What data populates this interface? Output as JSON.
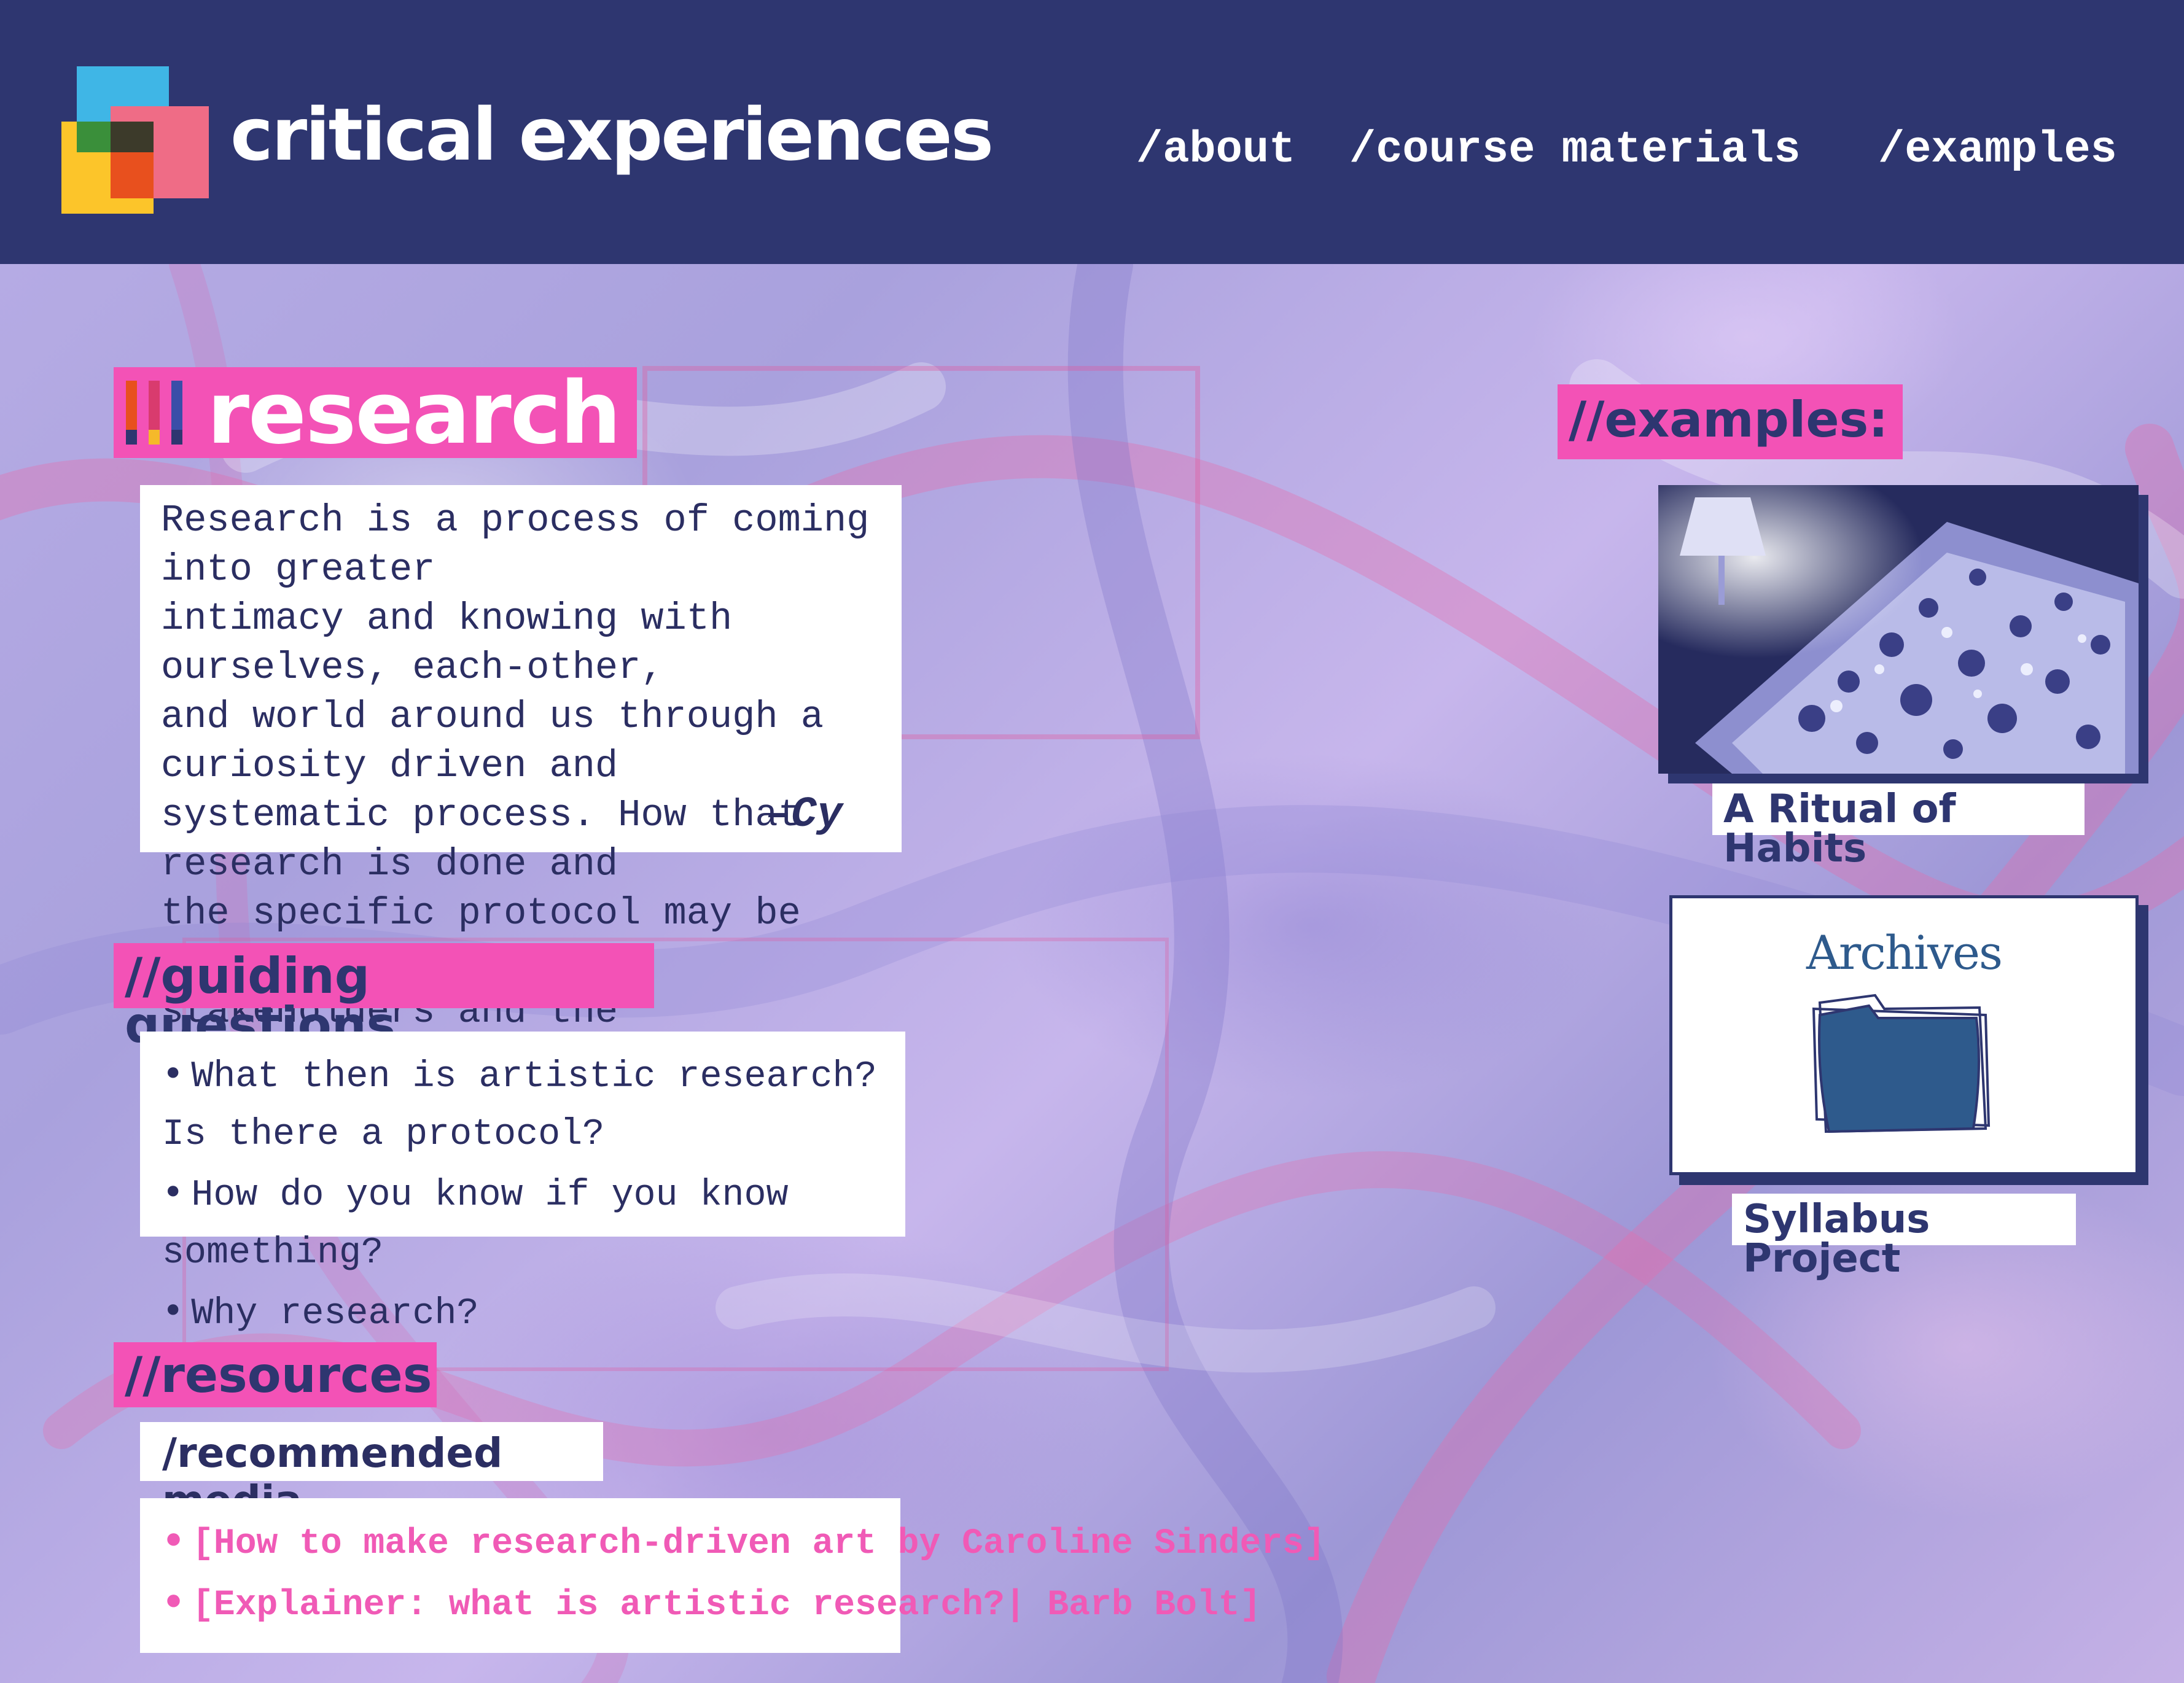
{
  "header": {
    "brand": "critical experiences",
    "nav": [
      {
        "label": "/about"
      },
      {
        "label": "/course materials"
      },
      {
        "label": "/examples"
      }
    ]
  },
  "page": {
    "title": "research"
  },
  "quote": {
    "lines": [
      "Research is a process of coming into greater",
      "intimacy and knowing with ourselves, each-other,",
      "and world around us through a curiosity driven and",
      "systematic process. How that research is done and",
      "the specific protocol may be dependent on",
      "stakeholders and the communities you are a part of."
    ],
    "signature": "–Cy"
  },
  "guiding": {
    "heading": "//guiding questions",
    "items": [
      "What then is artistic research? Is there a protocol?",
      "How do you know if you know something?",
      "Why research?"
    ]
  },
  "resources": {
    "heading": "//resources",
    "subheading": "/recommended media",
    "links": [
      "[How to make research-driven art by Caroline Sinders]",
      "[Explainer: what is artistic research?| Barb Bolt]"
    ]
  },
  "examples": {
    "heading": "//examples:",
    "items": [
      {
        "caption": "A Ritual of Habits"
      },
      {
        "caption": "Syllabus Project",
        "card_title": "Archives"
      }
    ]
  },
  "colors": {
    "navy": "#2e3670",
    "pink": "#f352b6",
    "link_pink": "#f05ab6",
    "text": "#2b2e62"
  }
}
